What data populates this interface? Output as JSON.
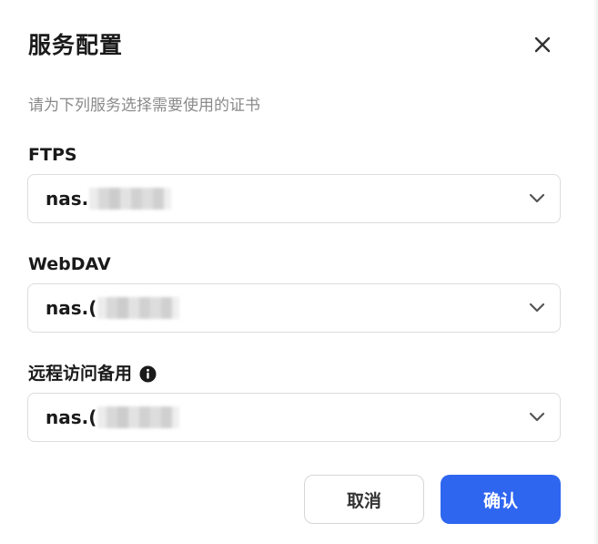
{
  "dialog": {
    "title": "服务配置",
    "subtitle": "请为下列服务选择需要使用的证书",
    "close_icon": "close-icon"
  },
  "fields": [
    {
      "label": "FTPS",
      "value": "nas.",
      "redacted": true
    },
    {
      "label": "WebDAV",
      "value": "nas.(",
      "redacted": true
    },
    {
      "label": "远程访问备用",
      "value": "nas.(",
      "redacted": true,
      "info_icon": "info-icon"
    }
  ],
  "buttons": {
    "cancel_label": "取消",
    "confirm_label": "确认"
  },
  "colors": {
    "primary": "#2f66f0",
    "border": "#dcdcdc",
    "subtitle": "#8a8a8a",
    "text": "#1a1a1a"
  }
}
